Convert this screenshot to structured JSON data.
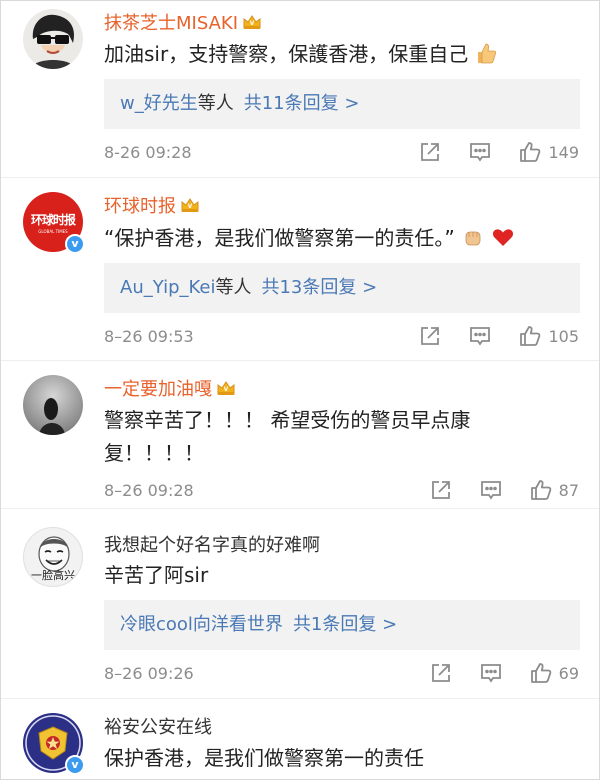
{
  "comments": [
    {
      "name": "抹茶芝士MISAKI",
      "text": "加油sir，支持警察，保護香港，保重自己",
      "emoji": "thumbs-up",
      "reply_user": "w_好先生",
      "reply_suffix": "等人",
      "reply_count": "共11条回复 >",
      "time": "8-26 09:28",
      "likes": "149"
    },
    {
      "name": "环球时报",
      "avatar_text": "环球时报",
      "avatar_sub": "GLOBAL TIMES",
      "text": "“保护香港，是我们做警察第一的责任。”",
      "emoji": "fist-and-heart",
      "reply_user": "Au_Yip_Kei",
      "reply_suffix": "等人",
      "reply_count": "共13条回复 >",
      "time": "8–26 09:53",
      "likes": "105"
    },
    {
      "name": "一定要加油嘎",
      "text": "警察辛苦了！！！ 希望受伤的警员早点康复！！！！",
      "time": "8–26 09:28",
      "likes": "87"
    },
    {
      "name": "我想起个好名字真的好难啊",
      "avatar_caption": "一脸高兴",
      "text": "辛苦了阿sir",
      "reply_user": "冷眼cool向洋看世界",
      "reply_count": "共1条回复 >",
      "time": "8–26 09:26",
      "likes": "69"
    },
    {
      "name": "裕安公安在线",
      "text": "保护香港，是我们做警察第一的责任"
    }
  ],
  "colors": {
    "vip_name": "#e8622b",
    "link": "#4a79b5",
    "meta": "#8c8c8c",
    "verified": "#3b9bf1"
  }
}
